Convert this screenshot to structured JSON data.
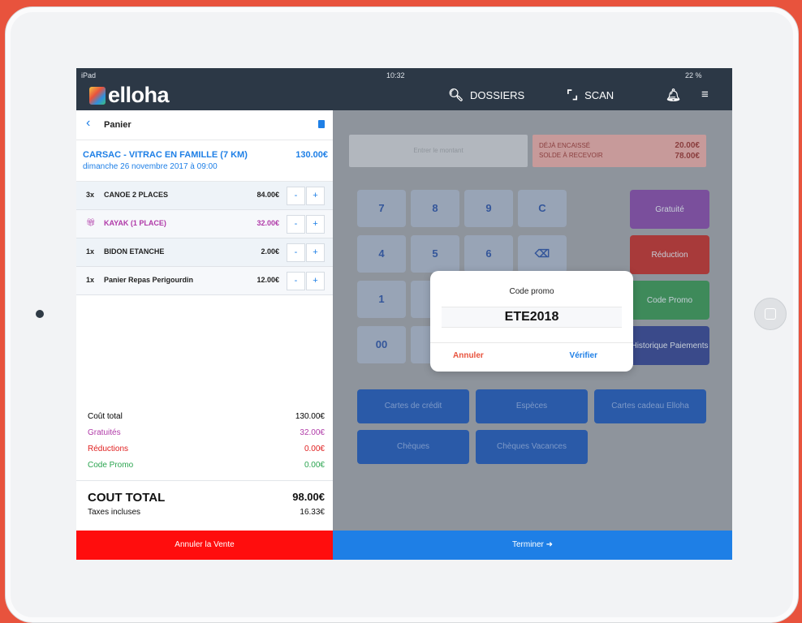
{
  "status": {
    "device": "iPad",
    "time": "10:32",
    "battery": "22 %"
  },
  "brand": {
    "name": "elloha"
  },
  "nav": {
    "dossiers": "DOSSIERS",
    "scan": "SCAN"
  },
  "panier": {
    "title": "Panier",
    "event": {
      "name": "CARSAC - VITRAC EN FAMILLE (7 KM)",
      "date": "dimanche 26 novembre 2017 à 09:00",
      "price": "130.00€"
    },
    "lines": [
      {
        "qty": "3x",
        "name": "CANOE 2 PLACES",
        "price": "84.00€",
        "gift": false
      },
      {
        "qty": "",
        "name": "KAYAK (1 PLACE)",
        "price": "32.00€",
        "gift": true
      },
      {
        "qty": "1x",
        "name": "BIDON ETANCHE",
        "price": "2.00€",
        "gift": false
      },
      {
        "qty": "1x",
        "name": "Panier Repas Perigourdin",
        "price": "12.00€",
        "gift": false
      }
    ],
    "step_minus": "-",
    "step_plus": "+",
    "totals": {
      "cout_total": {
        "label": "Coût total",
        "value": "130.00€"
      },
      "gratuites": {
        "label": "Gratuités",
        "value": "32.00€"
      },
      "reductions": {
        "label": "Réductions",
        "value": "0.00€"
      },
      "code_promo": {
        "label": "Code Promo",
        "value": "0.00€"
      },
      "grand": {
        "label": "COUT TOTAL",
        "value": "98.00€"
      },
      "taxes": {
        "label": "Taxes incluses",
        "value": "16.33€"
      }
    }
  },
  "payment": {
    "amount_placeholder": "Entrer le montant",
    "paid_label": "DÉJÀ ENCAISSÉ",
    "paid_value": "20.00€",
    "due_label": "SOLDE À RECEVOIR",
    "due_value": "78.00€",
    "keys": [
      "7",
      "8",
      "9",
      "C",
      "4",
      "5",
      "6",
      "⌫",
      "1",
      "",
      "",
      "",
      "00",
      "",
      ""
    ],
    "side_buttons": [
      "Gratuité",
      "Réduction",
      "Code Promo",
      "Historique Paiements"
    ],
    "methods": [
      "Cartes de crédit",
      "Espèces",
      "Cartes cadeau Elloha",
      "Chèques",
      "Chèques Vacances"
    ]
  },
  "modal": {
    "title": "Code promo",
    "code": "ETE2018",
    "cancel": "Annuler",
    "verify": "Vérifier"
  },
  "actions": {
    "cancel_sale": "Annuler la Vente",
    "finish": "Terminer ➜"
  },
  "colors": {
    "brand_red": "#e8533d",
    "blue": "#1e7fe6",
    "dark": "#2c3846",
    "gift_purple": "#b03aa8"
  }
}
